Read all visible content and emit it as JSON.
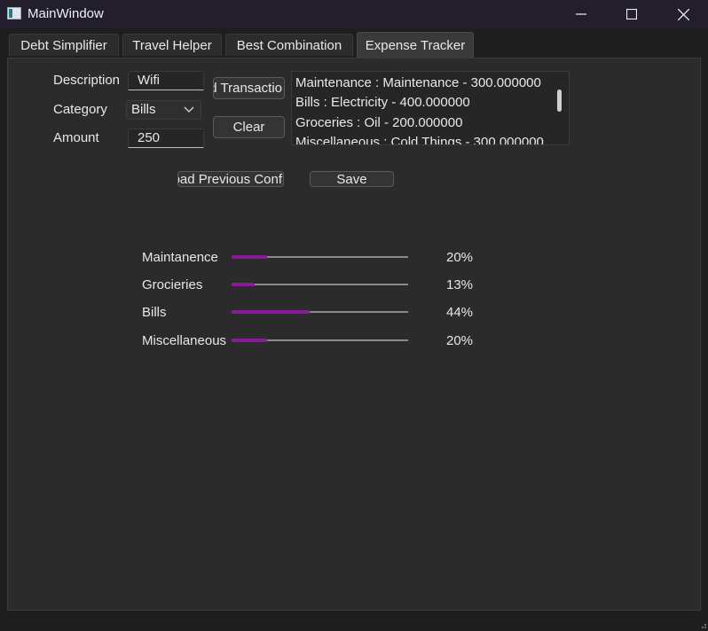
{
  "window": {
    "title": "MainWindow",
    "minimize_icon": "minimize-icon",
    "maximize_icon": "maximize-icon",
    "close_icon": "close-icon"
  },
  "tabs": [
    {
      "label": "Debt Simplifier",
      "active": false
    },
    {
      "label": "Travel Helper",
      "active": false
    },
    {
      "label": "Best Combination",
      "active": false
    },
    {
      "label": "Expense Tracker",
      "active": true
    }
  ],
  "form": {
    "description_label": "Description",
    "description_value": "Wifi",
    "category_label": "Category",
    "category_value": "Bills",
    "amount_label": "Amount",
    "amount_value": "250",
    "add_button": "ld Transactio",
    "clear_button": "Clear",
    "load_button": "oad Previous Conf",
    "save_button": "Save"
  },
  "transactions": [
    "Maintenance : Maintenance - 300.000000",
    "Bills : Electricity - 400.000000",
    "Groceries : Oil - 200.000000",
    "Miscellaneous : Cold Things - 300.000000"
  ],
  "breakdown": [
    {
      "label": "Maintanence",
      "value": 20,
      "text": "20%"
    },
    {
      "label": "Grocieries",
      "value": 13,
      "text": "13%"
    },
    {
      "label": "Bills",
      "value": 44,
      "text": "44%"
    },
    {
      "label": "Miscellaneous",
      "value": 20,
      "text": "20%"
    }
  ],
  "colors": {
    "accent": "#8a1a9a",
    "titlebar": "#221e2b",
    "pane": "#2b2b2b"
  }
}
